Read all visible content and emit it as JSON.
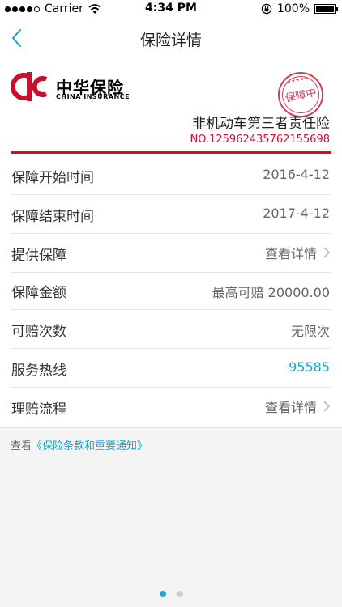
{
  "status_bar": {
    "carrier": "Carrier",
    "time": "4:34 PM",
    "battery": "100%"
  },
  "nav": {
    "title": "保险详情"
  },
  "brand": {
    "name_cn": "中华保险",
    "name_en": "CHINA INSURANCE",
    "stamp_text": "保障中"
  },
  "policy": {
    "type": "非机动车第三者责任险",
    "number": "NO.125962435762155698"
  },
  "rows": [
    {
      "label": "保障开始时间",
      "value": "2016-4-12"
    },
    {
      "label": "保障结束时间",
      "value": "2017-4-12"
    },
    {
      "label": "提供保障",
      "value": "查看详情"
    },
    {
      "label": "保障金额",
      "value": "最高可赔 20000.00"
    },
    {
      "label": "可赔次数",
      "value": "无限次"
    },
    {
      "label": "服务热线",
      "value": "95585"
    },
    {
      "label": "理赔流程",
      "value": "查看详情"
    }
  ],
  "notice": {
    "prefix": "查看",
    "link": "《保险条款和重要通知》"
  },
  "pager": {
    "pages": 2,
    "active": 1
  },
  "colors": {
    "accent": "#1aa3c8",
    "brand_red": "#d0101b",
    "background": "#f4f4f4"
  }
}
